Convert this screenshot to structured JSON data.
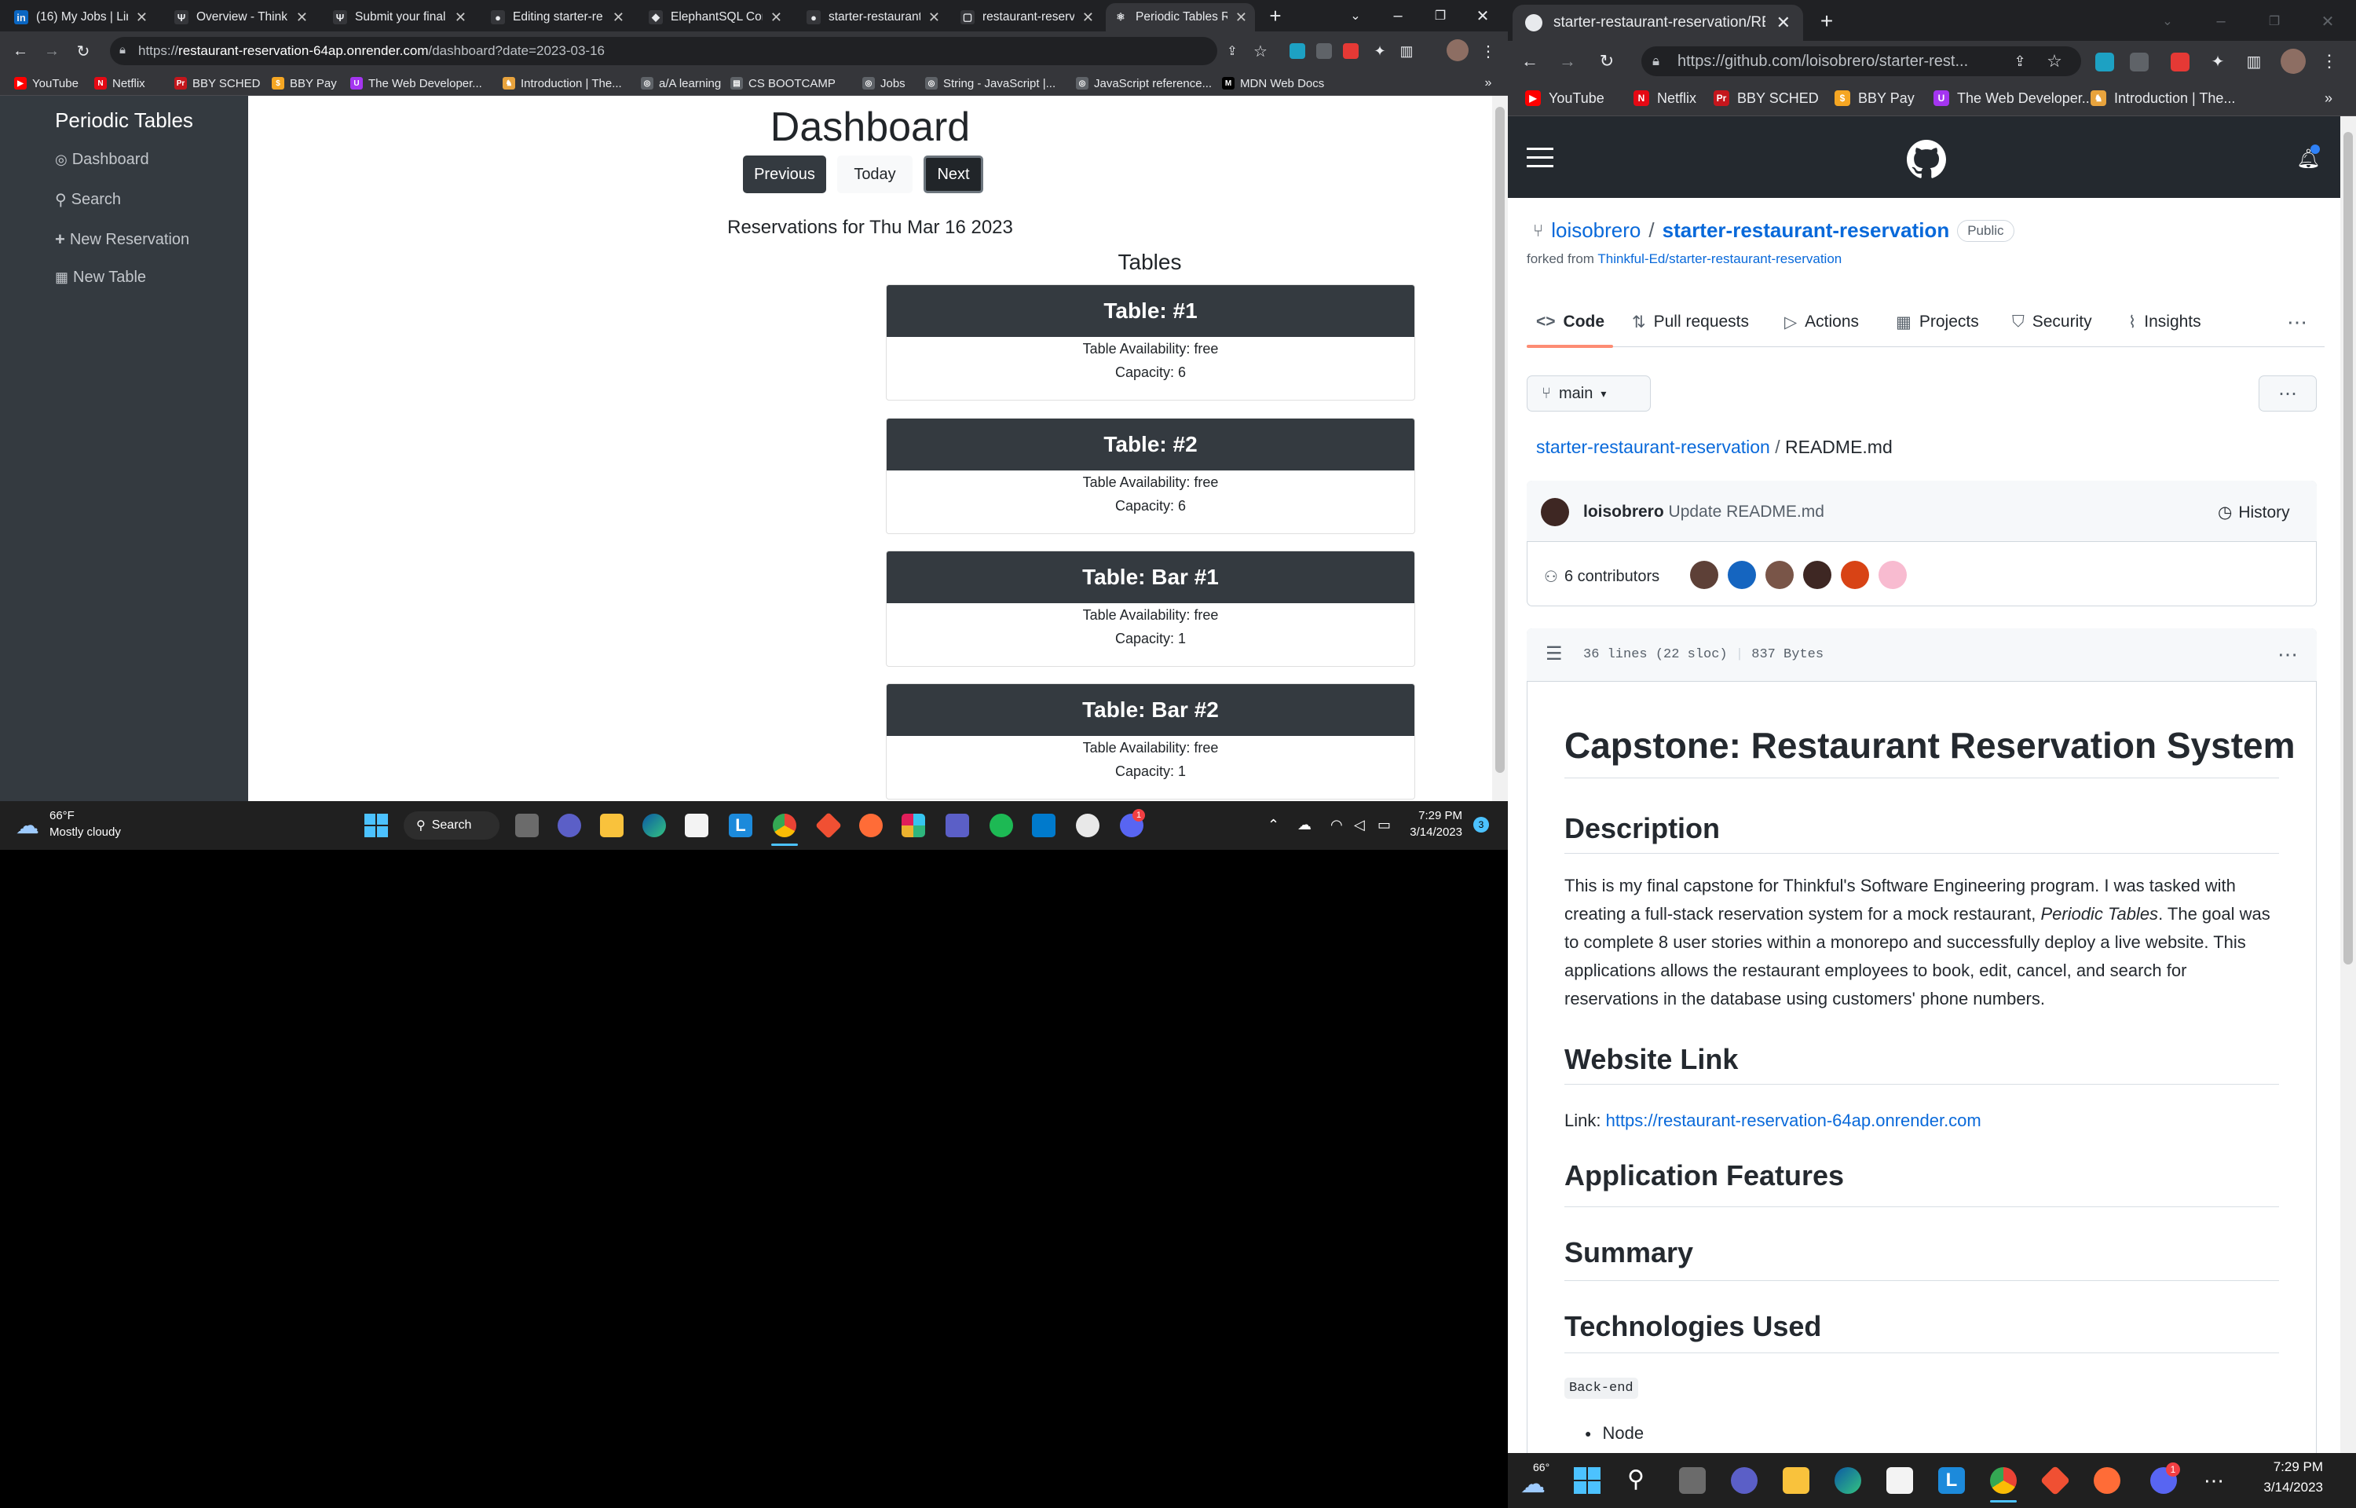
{
  "left_browser": {
    "tabs": [
      {
        "title": "(16) My Jobs | Lin",
        "icon": "linkedin-icon",
        "color": "#0a66c2",
        "glyph": "in"
      },
      {
        "title": "Overview - Think",
        "icon": "thinkful-icon",
        "color": "#35363a",
        "glyph": "Ψ"
      },
      {
        "title": "Submit your final",
        "icon": "thinkful-icon",
        "color": "#35363a",
        "glyph": "Ψ"
      },
      {
        "title": "Editing starter-re",
        "icon": "github-icon",
        "color": "#35363a",
        "glyph": "●"
      },
      {
        "title": "ElephantSQL Con",
        "icon": "elephantsql-icon",
        "color": "#35363a",
        "glyph": "◆"
      },
      {
        "title": "starter-restaurant",
        "icon": "github-icon",
        "color": "#35363a",
        "glyph": "●"
      },
      {
        "title": "restaurant-reserv",
        "icon": "render-icon",
        "color": "#35363a",
        "glyph": "▢"
      },
      {
        "title": "Periodic Tables Re",
        "icon": "react-icon",
        "color": "#35363a",
        "glyph": "⚛"
      }
    ],
    "url_scheme": "https://",
    "url_host": "restaurant-reservation-64ap.onrender.com",
    "url_path": "/dashboard?date=2023-03-16",
    "bookmarks": [
      {
        "label": "YouTube",
        "color": "#ff0000",
        "glyph": "▶"
      },
      {
        "label": "Netflix",
        "color": "#e50914",
        "glyph": "N"
      },
      {
        "label": "BBY SCHED",
        "color": "#c4161c",
        "glyph": "Pr"
      },
      {
        "label": "BBY Pay",
        "color": "#f5a623",
        "glyph": "$"
      },
      {
        "label": "The Web Developer...",
        "color": "#a435f0",
        "glyph": "U"
      },
      {
        "label": "Introduction | The...",
        "color": "#e8a33d",
        "glyph": "♞"
      },
      {
        "label": "a/A learning",
        "color": "#5f6368",
        "glyph": "◎"
      },
      {
        "label": "CS BOOTCAMP",
        "color": "#5f6368",
        "glyph": "▤"
      },
      {
        "label": "Jobs",
        "color": "#5f6368",
        "glyph": "◎"
      },
      {
        "label": "String - JavaScript |...",
        "color": "#5f6368",
        "glyph": "◎"
      },
      {
        "label": "JavaScript reference...",
        "color": "#5f6368",
        "glyph": "◎"
      },
      {
        "label": "MDN Web Docs",
        "color": "#000000",
        "glyph": "M"
      }
    ]
  },
  "app": {
    "brand": "Periodic Tables",
    "nav": [
      {
        "label": "Dashboard",
        "icon": "dashboard-icon"
      },
      {
        "label": "Search",
        "icon": "search-icon"
      },
      {
        "label": "New Reservation",
        "icon": "plus-icon"
      },
      {
        "label": "New Table",
        "icon": "table-icon"
      }
    ],
    "title": "Dashboard",
    "buttons": {
      "previous": "Previous",
      "today": "Today",
      "next": "Next"
    },
    "reservations_heading": "Reservations for Thu Mar 16 2023",
    "tables_heading": "Tables",
    "tables": [
      {
        "name": "Table: #1",
        "availability": "Table Availability: free",
        "capacity": "Capacity: 6"
      },
      {
        "name": "Table: #2",
        "availability": "Table Availability: free",
        "capacity": "Capacity: 6"
      },
      {
        "name": "Table: Bar #1",
        "availability": "Table Availability: free",
        "capacity": "Capacity: 1"
      },
      {
        "name": "Table: Bar #2",
        "availability": "Table Availability: free",
        "capacity": "Capacity: 1"
      }
    ]
  },
  "left_taskbar": {
    "weather_temp": "66°F",
    "weather_desc": "Mostly cloudy",
    "search_label": "Search",
    "time": "7:29 PM",
    "date": "3/14/2023",
    "notification_count": "3",
    "discord_badge": "1"
  },
  "right_browser": {
    "tab_title": "starter-restaurant-reservation/RE",
    "url": "https://github.com/loisobrero/starter-rest...",
    "bookmarks": [
      {
        "label": "YouTube",
        "color": "#ff0000",
        "glyph": "▶"
      },
      {
        "label": "Netflix",
        "color": "#e50914",
        "glyph": "N"
      },
      {
        "label": "BBY SCHED",
        "color": "#c4161c",
        "glyph": "Pr"
      },
      {
        "label": "BBY Pay",
        "color": "#f5a623",
        "glyph": "$"
      },
      {
        "label": "The Web Developer...",
        "color": "#a435f0",
        "glyph": "U"
      },
      {
        "label": "Introduction | The...",
        "color": "#e8a33d",
        "glyph": "♞"
      }
    ]
  },
  "github": {
    "owner": "loisobrero",
    "separator": "/",
    "repo": "starter-restaurant-reservation",
    "visibility": "Public",
    "forked_prefix": "forked from ",
    "forked_from": "Thinkful-Ed/starter-restaurant-reservation",
    "nav": [
      {
        "label": "Code",
        "icon": "code-icon"
      },
      {
        "label": "Pull requests",
        "icon": "pull-request-icon"
      },
      {
        "label": "Actions",
        "icon": "actions-icon"
      },
      {
        "label": "Projects",
        "icon": "projects-icon"
      },
      {
        "label": "Security",
        "icon": "shield-icon"
      },
      {
        "label": "Insights",
        "icon": "graph-icon"
      }
    ],
    "branch": "main",
    "breadcrumb_repo": "starter-restaurant-reservation",
    "breadcrumb_file": "README.md",
    "commit_author": "loisobrero",
    "commit_message": "Update README.md",
    "history_label": "History",
    "contributors_label": "6 contributors",
    "file_info_lines": "36 lines (22 sloc)",
    "file_info_size": "837 Bytes",
    "readme": {
      "h1": "Capstone: Restaurant Reservation System",
      "description_heading": "Description",
      "description_before_em": "This is my final capstone for Thinkful's Software Engineering program. I was tasked with creating a full-stack reservation system for a mock restaurant, ",
      "description_em": "Periodic Tables",
      "description_after_em": ". The goal was to complete 8 user stories within a monorepo and successfully deploy a live website. This applications allows the restaurant employees to book, edit, cancel, and search for reservations in the database using customers' phone numbers.",
      "website_heading": "Website Link",
      "link_label": "Link: ",
      "link_url": "https://restaurant-reservation-64ap.onrender.com",
      "features_heading": "Application Features",
      "summary_heading": "Summary",
      "tech_heading": "Technologies Used",
      "backend_label": "Back-end",
      "backend_first": "Node"
    }
  },
  "right_taskbar": {
    "weather_temp": "66°",
    "time": "7:29 PM",
    "date": "3/14/2023",
    "discord_badge": "1"
  }
}
